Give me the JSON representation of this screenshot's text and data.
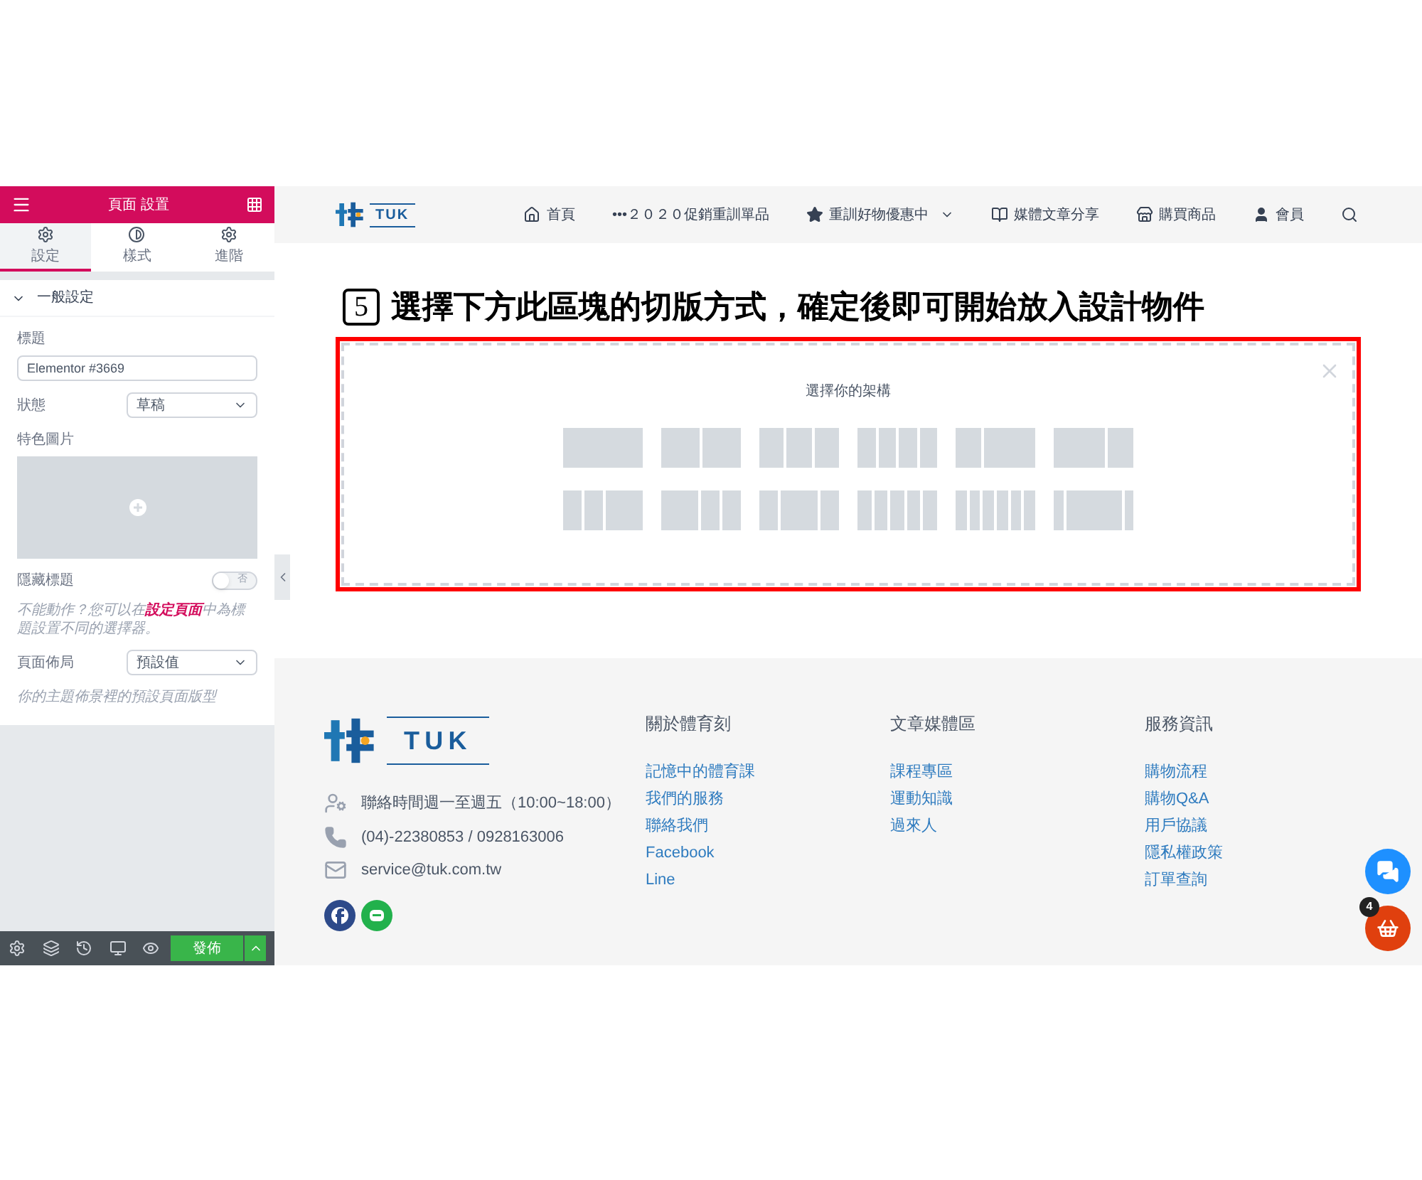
{
  "panel": {
    "title": "頁面 設置",
    "tabs": [
      {
        "label": "設定",
        "selected": true
      },
      {
        "label": "樣式",
        "selected": false
      },
      {
        "label": "進階",
        "selected": false
      }
    ],
    "section": {
      "title": "一般設定",
      "expanded": true
    },
    "title_field": {
      "label": "標題",
      "value": "Elementor #3669"
    },
    "status_field": {
      "label": "狀態",
      "value": "草稿"
    },
    "image_field": {
      "label": "特色圖片"
    },
    "hide_title": {
      "label": "隱藏標題",
      "on": false,
      "state_text": "否"
    },
    "help": {
      "before": "不能動作？您可以在",
      "link": "設定頁面",
      "after": "中為標題設置不同的選擇器。"
    },
    "layout_field": {
      "label": "頁面佈局",
      "value": "預設值"
    },
    "layout_hint": "你的主題佈景裡的預設頁面版型",
    "publish": "發佈"
  },
  "site": {
    "logo": "TUK",
    "nav": [
      {
        "kind": "home",
        "label": "首頁"
      },
      {
        "kind": "dots",
        "label": "•••２０２０促銷重訓單品"
      },
      {
        "kind": "star",
        "label": "重訓好物優惠中",
        "dropdown": true
      },
      {
        "kind": "book",
        "label": "媒體文章分享"
      },
      {
        "kind": "store",
        "label": "購買商品"
      },
      {
        "kind": "user",
        "label": "會員"
      }
    ],
    "heading": {
      "step": "5",
      "text": "選擇下方此區塊的切版方式，確定後即可開始放入設計物件"
    },
    "structure": {
      "title": "選擇你的架構"
    },
    "footer": {
      "logo": "TUK",
      "contacts": [
        {
          "kind": "hours",
          "text": "聯絡時間週一至週五（10:00~18:00）"
        },
        {
          "kind": "phone",
          "text": "(04)-22380853 / 0928163006"
        },
        {
          "kind": "mail",
          "text": "service@tuk.com.tw"
        }
      ],
      "columns": [
        {
          "title": "關於體育刻",
          "links": [
            "記憶中的體育課",
            "我們的服務",
            "聯絡我們",
            "Facebook",
            "Line"
          ]
        },
        {
          "title": "文章媒體區",
          "links": [
            "課程專區",
            "運動知識",
            "過來人"
          ]
        },
        {
          "title": "服務資訊",
          "links": [
            "購物流程",
            "購物Q&A",
            "用戶協議",
            "隱私權政策",
            "訂單查詢"
          ]
        }
      ]
    },
    "cart_count": "4"
  }
}
